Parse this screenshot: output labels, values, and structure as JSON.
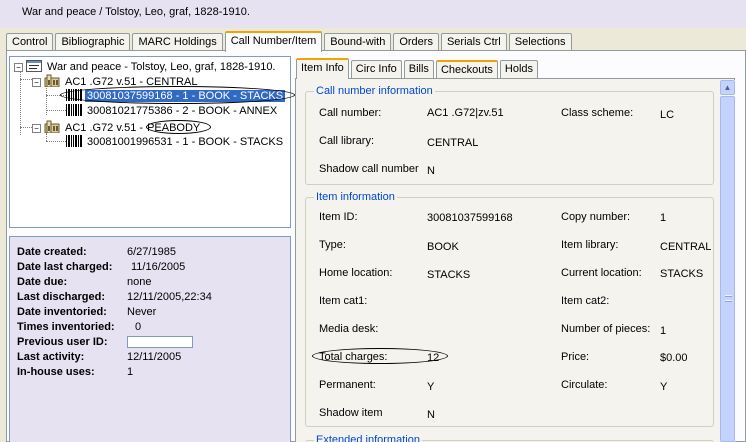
{
  "record_title": "War and peace / Tolstoy, Leo, graf, 1828-1910.",
  "tabs": [
    "Control",
    "Bibliographic",
    "MARC Holdings",
    "Call Number/Item",
    "Bound-with",
    "Orders",
    "Serials Ctrl",
    "Selections"
  ],
  "active_tab": "Call Number/Item",
  "tree": {
    "root": "War and peace - Tolstoy, Leo, graf, 1828-1910.",
    "call1": "AC1 .G72 v.51 - CENTRAL",
    "item1": "30081037599168 - 1 - BOOK - STACKS",
    "item2": "30081021775386 - 2 - BOOK - ANNEX",
    "call2": "AC1 .G72 v.51 -",
    "call2_lib": "PEABODY",
    "item3": "30081001996531 - 1 - BOOK - STACKS"
  },
  "details": {
    "date_created_label": "Date created:",
    "date_created": "6/27/1985",
    "last_charged_label": "Date last charged:",
    "last_charged": "11/16/2005",
    "date_due_label": "Date due:",
    "date_due": "none",
    "last_discharged_label": "Last discharged:",
    "last_discharged": "12/11/2005,22:34",
    "date_inventoried_label": "Date inventoried:",
    "date_inventoried": "Never",
    "times_inventoried_label": "Times inventoried:",
    "times_inventoried": "0",
    "previous_user_label": "Previous user ID:",
    "previous_user": "",
    "last_activity_label": "Last activity:",
    "last_activity": "12/11/2005",
    "inhouse_label": "In-house uses:",
    "inhouse": "1"
  },
  "subtabs": [
    "Item Info",
    "Circ Info",
    "Bills",
    "Checkouts",
    "Holds"
  ],
  "callnum": {
    "legend": "Call number information",
    "call_number_label": "Call number:",
    "call_number": "AC1 .G72|zv.51",
    "class_scheme_label": "Class scheme:",
    "class_scheme": "LC",
    "call_library_label": "Call library:",
    "call_library": "CENTRAL",
    "shadow_label": "Shadow call number",
    "shadow": "N"
  },
  "item": {
    "legend": "Item information",
    "item_id_label": "Item ID:",
    "item_id": "30081037599168",
    "copy_label": "Copy number:",
    "copy": "1",
    "type_label": "Type:",
    "type": "BOOK",
    "item_library_label": "Item library:",
    "item_library": "CENTRAL",
    "home_label": "Home location:",
    "home": "STACKS",
    "current_label": "Current location:",
    "current": "STACKS",
    "cat1_label": "Item cat1:",
    "cat1": "",
    "cat2_label": "Item cat2:",
    "cat2": "",
    "media_label": "Media desk:",
    "media": "",
    "pieces_label": "Number of pieces:",
    "pieces": "1",
    "total_charges_label": "Total charges:",
    "total_charges": "12",
    "price_label": "Price:",
    "price": "$0.00",
    "permanent_label": "Permanent:",
    "permanent": "Y",
    "circulate_label": "Circulate:",
    "circulate": "Y",
    "shadow_item_label": "Shadow item",
    "shadow_item": "N"
  },
  "extended": {
    "legend": "Extended information"
  },
  "colors": {
    "selection": "#316ac5",
    "legend_text": "#0046d5",
    "active_tab_accent": "#f0a400"
  }
}
